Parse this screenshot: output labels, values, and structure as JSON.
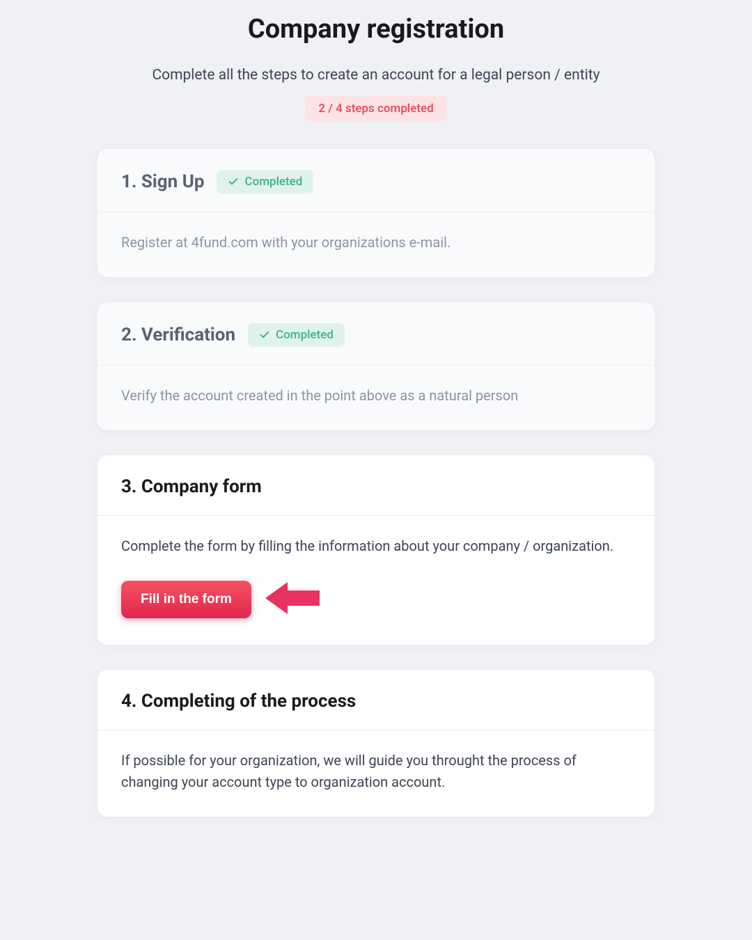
{
  "header": {
    "title": "Company registration",
    "subtitle": "Complete all the steps to create an account for a legal person / entity",
    "progress_label": "2 / 4 steps completed"
  },
  "completed_badge_label": "Completed",
  "steps": [
    {
      "title": "1. Sign Up",
      "description": "Register at 4fund.com with your organizations e-mail.",
      "completed": true
    },
    {
      "title": "2. Verification",
      "description": "Verify the account created in the point above as a natural person",
      "completed": true
    },
    {
      "title": "3. Company form",
      "description": "Complete the form by filling the information about your company / organization.",
      "completed": false,
      "action_label": "Fill in the form"
    },
    {
      "title": "4. Completing of the process",
      "description": "If possible for your organization, we will guide you throught the process of changing your account type to organization account.",
      "completed": false
    }
  ]
}
